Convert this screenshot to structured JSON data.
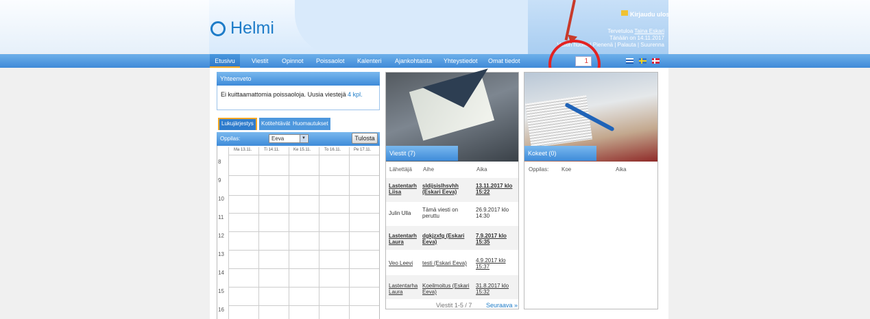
{
  "header": {
    "logo_text": "Helmi",
    "logout_label": "Kirjaudu ulos",
    "welcome_prefix": "Tervetuloa",
    "welcome_user": "Taina Eskari",
    "today": "Tänään on 14.11.2017",
    "links": "Vastin huolto | Pienenä | Palauta | Suurenna"
  },
  "nav": {
    "items": [
      "Etusivu",
      "Viestit",
      "Opinnot",
      "Poissaolot",
      "Kalenteri",
      "Ajankohtaista",
      "Yhteystiedot",
      "Omat tiedot"
    ],
    "message_count": "1"
  },
  "summary": {
    "title": "Yhteenveto",
    "text": "Ei kuittaamattomia poissaoloja. Uusia viestejä",
    "link": "4 kpl."
  },
  "schedule": {
    "tabs": [
      "Lukujärjestys",
      "Kotitehtävät",
      "Huomautukset"
    ],
    "student_label": "Oppilas:",
    "student_value": "Eeva",
    "print_label": "Tulosta",
    "days": [
      "Ma 13.11.",
      "Ti 14.11.",
      "Ke 15.11.",
      "To 16.11.",
      "Pe 17.11."
    ],
    "hours": [
      "8",
      "9",
      "10",
      "11",
      "12",
      "13",
      "14",
      "15",
      "16"
    ]
  },
  "messages": {
    "title": "Viestit (7)",
    "columns": [
      "Lähettäjä",
      "Aihe",
      "Aika"
    ],
    "rows": [
      {
        "sender": "Lastentarh Liisa",
        "subject": "sldijsislhsvhh (Eskari Eeva)",
        "time": "13.11.2017 klo 15:22",
        "unread": true
      },
      {
        "sender": "Julin Ulla",
        "subject": "Tämä viesti on peruttu",
        "time": "26.9.2017 klo 14:30",
        "unread": false
      },
      {
        "sender": "Lastentarh Laura",
        "subject": "dgkjzxfg (Eskari Eeva)",
        "time": "7.9.2017 klo 15:35",
        "unread": true
      },
      {
        "sender": "Veo Leevi",
        "subject": "testi (Eskari Eeva)",
        "time": "4.9.2017 klo 15:37",
        "unread": false
      },
      {
        "sender": "Lastentarha Laura",
        "subject": "Koeilmoitus (Eskari Eeva)",
        "time": "31.8.2017 klo 15:32",
        "unread": false
      }
    ],
    "pager": "Viestit 1-5 / 7",
    "next": "Seuraava »"
  },
  "exams": {
    "title": "Kokeet (0)",
    "columns": [
      "Oppilas:",
      "Koe",
      "Aika"
    ]
  },
  "colors": {
    "accent": "#3e8bd9",
    "brand": "#1e7cc8",
    "annotation": "#e32222"
  }
}
